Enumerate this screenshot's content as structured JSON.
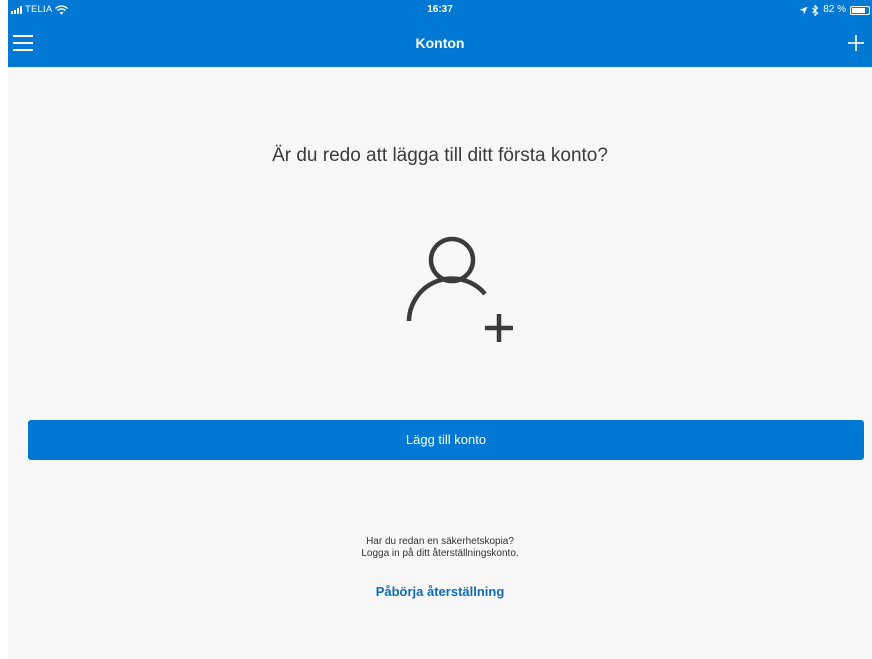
{
  "colors": {
    "accent": "#0078d4",
    "background": "#f7f7f7",
    "link": "#0f6cbd",
    "heading_text": "#3b3b3b"
  },
  "status_bar": {
    "carrier": "TELIA",
    "time": "16:37",
    "battery_text": "82 %",
    "battery_level": 0.82,
    "icons": [
      "signal-icon",
      "wifi-icon",
      "location-arrow-icon",
      "bluetooth-icon",
      "battery-icon"
    ]
  },
  "nav": {
    "title": "Konton",
    "left_icon": "menu-icon",
    "right_icon": "plus-icon"
  },
  "main": {
    "question": "Är du redo att lägga till ditt första konto?",
    "illustration_icon": "person-add-icon",
    "add_account_label": "Lägg till konto",
    "backup_line1": "Har du redan en säkerhetskopia?",
    "backup_line2": "Logga in på ditt återställningskonto.",
    "restore_link_label": "Påbörja återställning"
  }
}
